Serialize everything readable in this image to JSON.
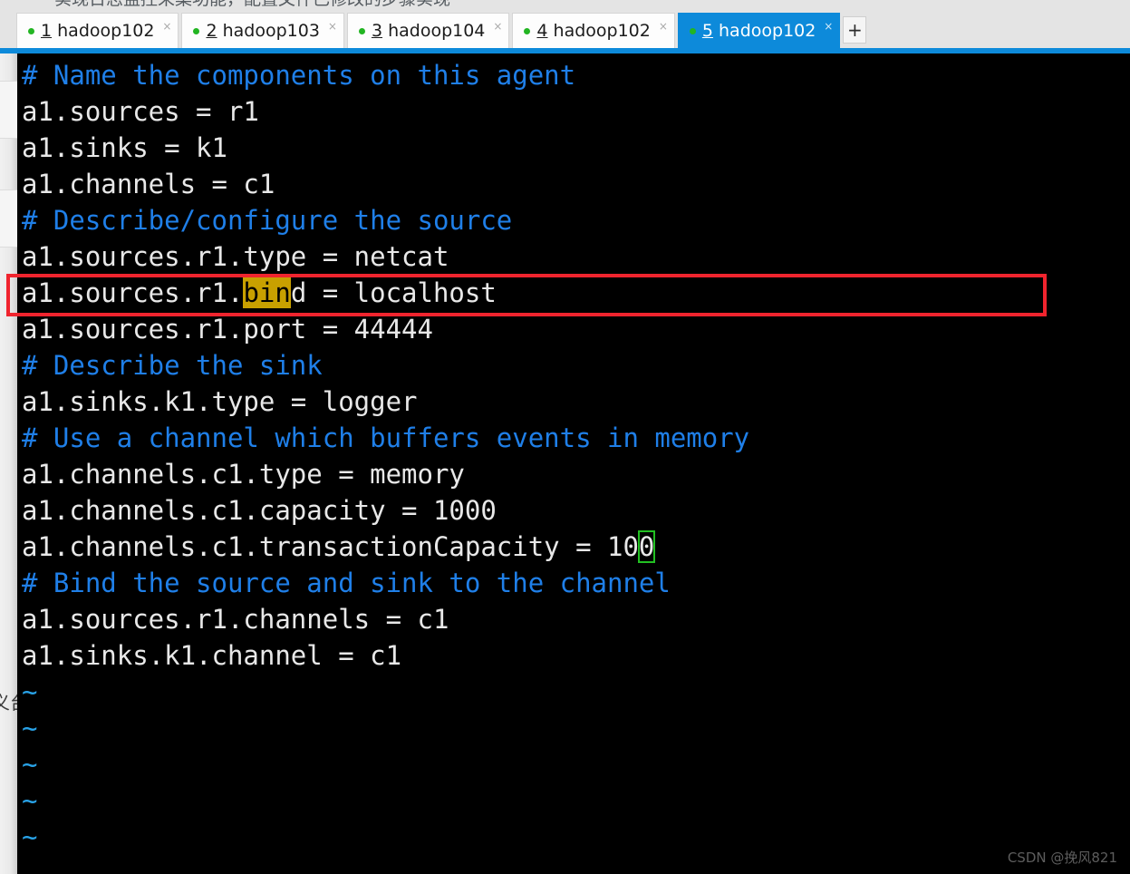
{
  "window": {
    "cut_off_header_text": "实现日志监控采集功能，配置文件已修改的步骤实现"
  },
  "tabbar": {
    "tabs": [
      {
        "index": "1",
        "host": "hadoop102",
        "status_color": "#22b522",
        "active": false,
        "close_label": "×"
      },
      {
        "index": "2",
        "host": "hadoop103",
        "status_color": "#22b522",
        "active": false,
        "close_label": "×"
      },
      {
        "index": "3",
        "host": "hadoop104",
        "status_color": "#22b522",
        "active": false,
        "close_label": "×"
      },
      {
        "index": "4",
        "host": "hadoop102",
        "status_color": "#22b522",
        "active": false,
        "close_label": "×"
      },
      {
        "index": "5",
        "host": "hadoop102",
        "status_color": "#22b522",
        "active": true,
        "close_label": "×"
      }
    ],
    "add_tab_label": "+",
    "active_tab_color": "#0d8ada",
    "separator_color": "#0d8ada"
  },
  "terminal": {
    "background": "#000000",
    "comment_color": "#1f7fe8",
    "text_color": "#e8e8e8",
    "tilde_color": "#29a3e8",
    "search_highlight_color": "#c8a000",
    "search_highlight_text": "bin",
    "cursor_outline_color": "#22c022",
    "lines": [
      {
        "kind": "comment",
        "text": "# Name the components on this agent"
      },
      {
        "kind": "text",
        "text": "a1.sources = r1"
      },
      {
        "kind": "text",
        "text": "a1.sinks = k1"
      },
      {
        "kind": "text",
        "text": "a1.channels = c1"
      },
      {
        "kind": "comment",
        "text": "# Describe/configure the source"
      },
      {
        "kind": "text",
        "text": "a1.sources.r1.type = netcat"
      },
      {
        "kind": "text_highlight",
        "pre": "a1.sources.r1.",
        "hl": "bin",
        "post": "d = localhost"
      },
      {
        "kind": "text",
        "text": "a1.sources.r1.port = 44444"
      },
      {
        "kind": "comment",
        "text": "# Describe the sink"
      },
      {
        "kind": "text",
        "text": "a1.sinks.k1.type = logger"
      },
      {
        "kind": "comment",
        "text": "# Use a channel which buffers events in memory"
      },
      {
        "kind": "text",
        "text": "a1.channels.c1.type = memory"
      },
      {
        "kind": "text",
        "text": "a1.channels.c1.capacity = 1000"
      },
      {
        "kind": "text_cursor",
        "pre": "a1.channels.c1.transactionCapacity = 10",
        "cur": "0",
        "post": ""
      },
      {
        "kind": "comment",
        "text": "# Bind the source and sink to the channel"
      },
      {
        "kind": "text",
        "text": "a1.sources.r1.channels = c1"
      },
      {
        "kind": "text",
        "text": "a1.sinks.k1.channel = c1"
      },
      {
        "kind": "tilde",
        "text": "~"
      },
      {
        "kind": "tilde",
        "text": "~"
      },
      {
        "kind": "tilde",
        "text": "~"
      },
      {
        "kind": "tilde",
        "text": "~"
      },
      {
        "kind": "tilde",
        "text": "~"
      }
    ]
  },
  "annotations": {
    "red_box_color": "#f0242e",
    "red_box_target_line": "a1.sources.r1.bind = localhost"
  },
  "left_gutter": {
    "cut_off_text": "义台"
  },
  "watermark": {
    "text": "CSDN @挽风821"
  }
}
